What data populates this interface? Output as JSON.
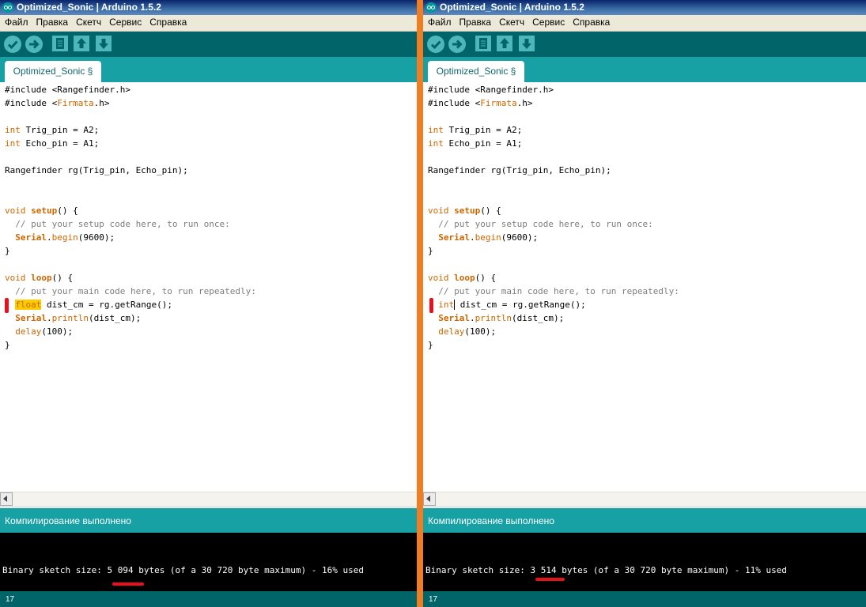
{
  "colors": {
    "separator": "#f07d22",
    "toolbar": "#006468",
    "tabstrip": "#17a1a5",
    "keyword": "#cc6600",
    "comment": "#7e7e7e",
    "highlight": "#ffcc00",
    "annotation": "#e8101b"
  },
  "panes": [
    {
      "title": "Optimized_Sonic | Arduino 1.5.2",
      "menu": [
        "Файл",
        "Правка",
        "Скетч",
        "Сервис",
        "Справка"
      ],
      "toolbar_icons": [
        "verify-icon",
        "upload-icon",
        "new-icon",
        "open-icon",
        "save-icon"
      ],
      "tab_label": "Optimized_Sonic §",
      "code": {
        "l1_pre": "#include <",
        "l1_name": "Rangefinder",
        "l1_post": ".h>",
        "l2_pre": "#include <",
        "l2_name": "Firmata",
        "l2_post": ".h>",
        "l3_type": "int",
        "l3_rest": " Trig_pin = A2;",
        "l4_type": "int",
        "l4_rest": " Echo_pin = A1;",
        "l5": "Rangefinder rg(Trig_pin, Echo_pin);",
        "l6_void": "void ",
        "l6_func": "setup",
        "l6_rest": "() {",
        "l7": "  // put your setup code here, to run once:",
        "l8_indent": "  ",
        "l8_obj": "Serial",
        "l8_dot": ".",
        "l8_method": "begin",
        "l8_rest": "(9600);",
        "l9": "}",
        "l10_void": "void ",
        "l10_func": "loop",
        "l10_rest": "() {",
        "l11": "  // put your main code here, to run repeatedly:",
        "l12_indent": "  ",
        "l12_type": "float",
        "l12_rest": " dist_cm = rg.getRange();",
        "l13_indent": "  ",
        "l13_obj": "Serial",
        "l13_dot": ".",
        "l13_method": "println",
        "l13_rest": "(dist_cm);",
        "l14_indent": "  ",
        "l14_method": "delay",
        "l14_rest": "(100);",
        "l15": "}"
      },
      "status": "Компилирование выполнено",
      "console_pre": "Binary sketch size: ",
      "console_size": "5 094",
      "console_post": " bytes (of a 30 720 byte maximum) - 16% used",
      "line_number": "17"
    },
    {
      "title": "Optimized_Sonic | Arduino 1.5.2",
      "menu": [
        "Файл",
        "Правка",
        "Скетч",
        "Сервис",
        "Справка"
      ],
      "toolbar_icons": [
        "verify-icon",
        "upload-icon",
        "new-icon",
        "open-icon",
        "save-icon"
      ],
      "tab_label": "Optimized_Sonic §",
      "code": {
        "l1_pre": "#include <",
        "l1_name": "Rangefinder",
        "l1_post": ".h>",
        "l2_pre": "#include <",
        "l2_name": "Firmata",
        "l2_post": ".h>",
        "l3_type": "int",
        "l3_rest": " Trig_pin = A2;",
        "l4_type": "int",
        "l4_rest": " Echo_pin = A1;",
        "l5": "Rangefinder rg(Trig_pin, Echo_pin);",
        "l6_void": "void ",
        "l6_func": "setup",
        "l6_rest": "() {",
        "l7": "  // put your setup code here, to run once:",
        "l8_indent": "  ",
        "l8_obj": "Serial",
        "l8_dot": ".",
        "l8_method": "begin",
        "l8_rest": "(9600);",
        "l9": "}",
        "l10_void": "void ",
        "l10_func": "loop",
        "l10_rest": "() {",
        "l11": "  // put your main code here, to run repeatedly:",
        "l12_indent": "  ",
        "l12_type": "int",
        "l12_rest": " dist_cm = rg.getRange();",
        "l13_indent": "  ",
        "l13_obj": "Serial",
        "l13_dot": ".",
        "l13_method": "println",
        "l13_rest": "(dist_cm);",
        "l14_indent": "  ",
        "l14_method": "delay",
        "l14_rest": "(100);",
        "l15": "}"
      },
      "status": "Компилирование выполнено",
      "console_pre": "Binary sketch size: ",
      "console_size": "3 514",
      "console_post": " bytes (of a 30 720 byte maximum) - 11% used",
      "line_number": "17"
    }
  ]
}
